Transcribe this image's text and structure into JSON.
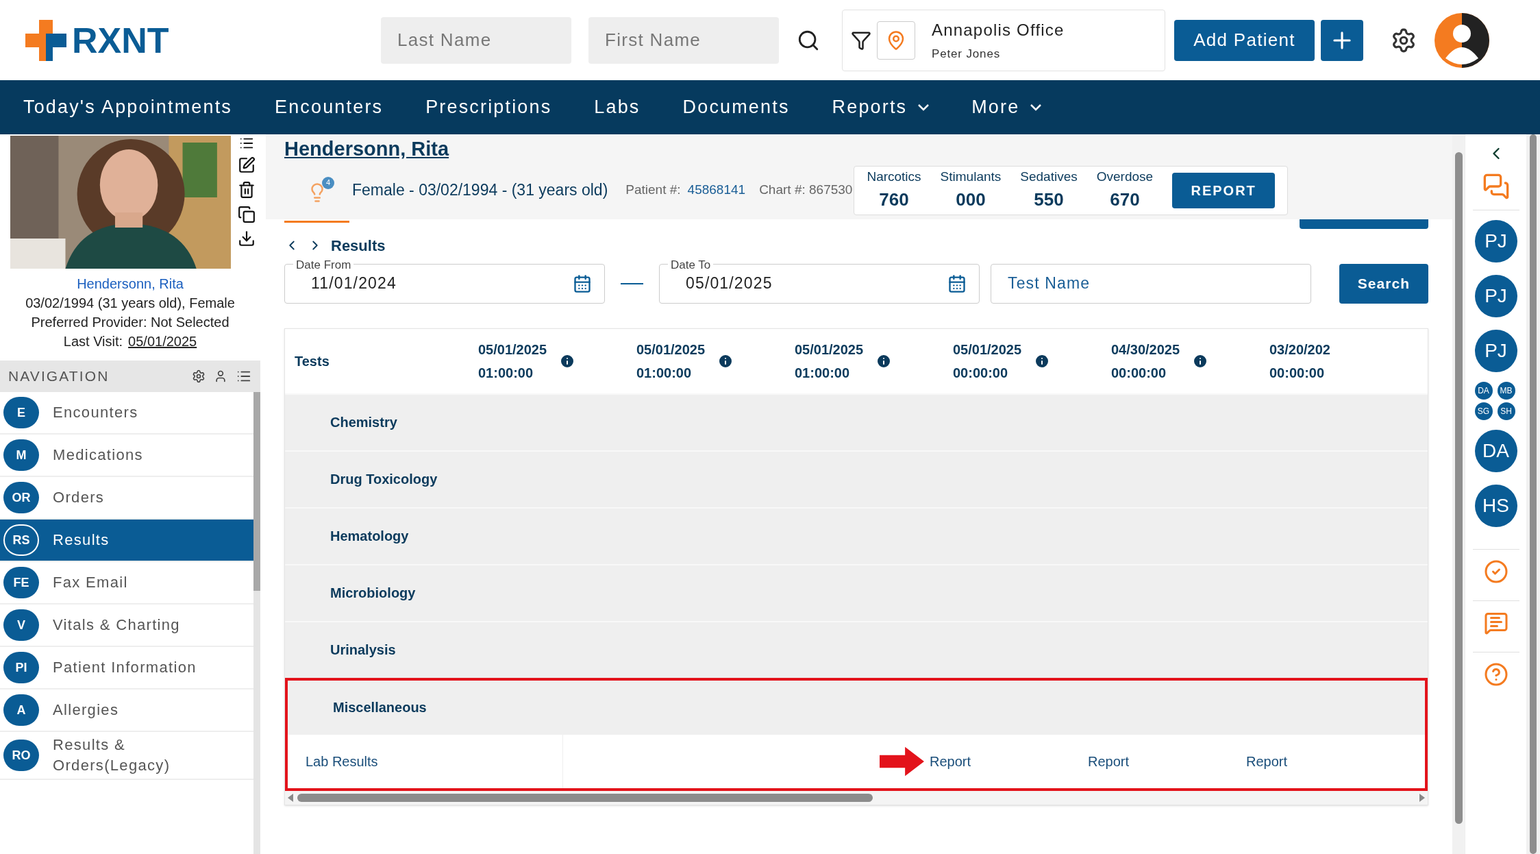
{
  "header": {
    "logo": "RXNT",
    "last_name": {
      "placeholder": "Last Name"
    },
    "first_name": {
      "placeholder": "First Name"
    },
    "location": {
      "office": "Annapolis Office",
      "user": "Peter Jones"
    },
    "add_patient": "Add Patient"
  },
  "menu": [
    {
      "label": "Today's Appointments",
      "dropdown": false
    },
    {
      "label": "Encounters",
      "dropdown": false
    },
    {
      "label": "Prescriptions",
      "dropdown": false
    },
    {
      "label": "Labs",
      "dropdown": false
    },
    {
      "label": "Documents",
      "dropdown": false
    },
    {
      "label": "Reports",
      "dropdown": true
    },
    {
      "label": "More",
      "dropdown": true
    }
  ],
  "patient_card": {
    "name": "Hendersonn, Rita",
    "dob": "03/02/1994 (31 years old), Female",
    "provider": "Preferred Provider: Not Selected",
    "last_visit_label": "Last Visit:",
    "last_visit": "05/01/2025"
  },
  "navigation": {
    "title": "NAVIGATION",
    "items": [
      {
        "badge": "E",
        "label": "Encounters",
        "selected": false
      },
      {
        "badge": "M",
        "label": "Medications",
        "selected": false
      },
      {
        "badge": "OR",
        "label": "Orders",
        "selected": false
      },
      {
        "badge": "RS",
        "label": "Results",
        "selected": true
      },
      {
        "badge": "FE",
        "label": "Fax Email",
        "selected": false
      },
      {
        "badge": "V",
        "label": "Vitals & Charting",
        "selected": false
      },
      {
        "badge": "PI",
        "label": "Patient Information",
        "selected": false
      },
      {
        "badge": "A",
        "label": "Allergies",
        "selected": false
      },
      {
        "badge": "RO",
        "label": "Results & Orders(Legacy)",
        "selected": false
      }
    ]
  },
  "patient_header": {
    "name": "Hendersonn, Rita",
    "alert_count": "4",
    "demographics": "Female - 03/02/1994 - (31 years old)",
    "patient_label": "Patient #:",
    "patient_number": "45868141",
    "chart": "Chart #: 867530"
  },
  "counters": [
    {
      "label": "Narcotics",
      "value": "760"
    },
    {
      "label": "Stimulants",
      "value": "000"
    },
    {
      "label": "Sedatives",
      "value": "550"
    },
    {
      "label": "Overdose",
      "value": "670"
    }
  ],
  "report_button": "REPORT",
  "results": {
    "title": "Results",
    "date_from": {
      "label": "Date From",
      "value": "11/01/2024"
    },
    "date_to": {
      "label": "Date To",
      "value": "05/01/2025"
    },
    "test_name": {
      "placeholder": "Test Name"
    },
    "search_button": "Search"
  },
  "table": {
    "first_column": "Tests",
    "columns": [
      {
        "date": "05/01/2025",
        "time": "01:00:00"
      },
      {
        "date": "05/01/2025",
        "time": "01:00:00"
      },
      {
        "date": "05/01/2025",
        "time": "01:00:00"
      },
      {
        "date": "05/01/2025",
        "time": "00:00:00"
      },
      {
        "date": "04/30/2025",
        "time": "00:00:00"
      },
      {
        "date": "03/20/202",
        "time": "00:00:00"
      }
    ],
    "groups": [
      {
        "label": "Chemistry",
        "highlighted": false
      },
      {
        "label": "Drug Toxicology",
        "highlighted": false
      },
      {
        "label": "Hematology",
        "highlighted": false
      },
      {
        "label": "Microbiology",
        "highlighted": false
      },
      {
        "label": "Urinalysis",
        "highlighted": false
      },
      {
        "label": "Miscellaneous",
        "highlighted": true
      }
    ],
    "detail_row": {
      "label": "Lab Results",
      "reports": [
        {
          "label": "Report",
          "marked": true
        },
        {
          "label": "Report",
          "marked": false
        },
        {
          "label": "Report",
          "marked": false
        }
      ]
    }
  },
  "right_rail": {
    "avatars": [
      {
        "initials": "PJ",
        "kind": "large"
      },
      {
        "initials": "PJ",
        "kind": "large"
      },
      {
        "initials": "PJ",
        "kind": "large"
      },
      {
        "initials": "DA",
        "kind": "small"
      },
      {
        "initials": "MB",
        "kind": "small"
      },
      {
        "initials": "SG",
        "kind": "small"
      },
      {
        "initials": "SH",
        "kind": "small"
      },
      {
        "initials": "DA",
        "kind": "large"
      },
      {
        "initials": "HS",
        "kind": "large"
      }
    ]
  }
}
